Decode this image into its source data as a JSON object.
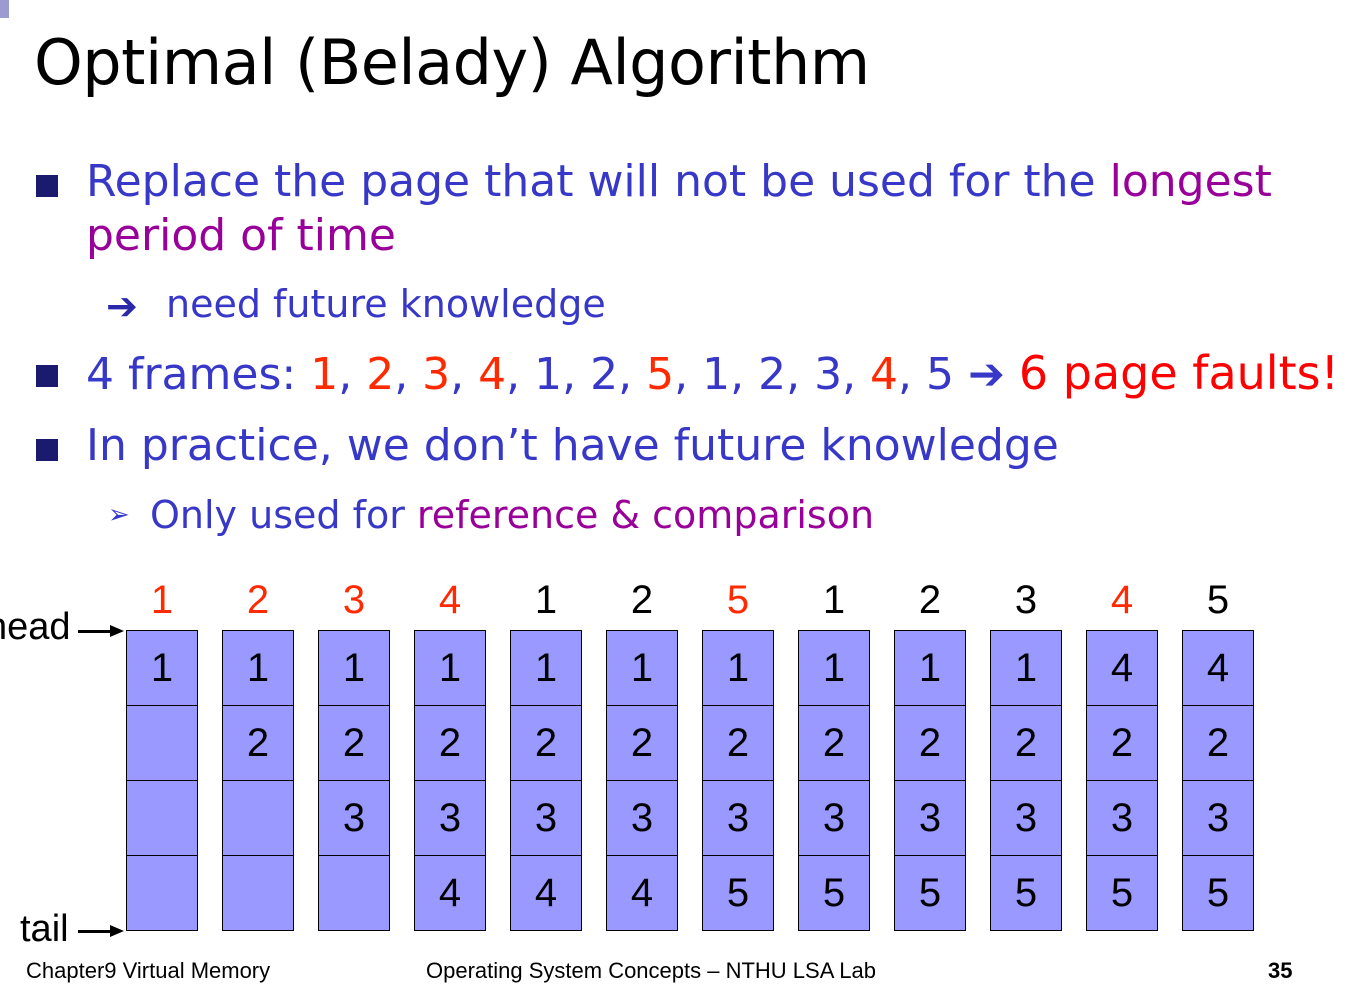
{
  "title": "Optimal (Belady) Algorithm",
  "bullets": {
    "b1_part1": "Replace the page that will not be used for the ",
    "b1_part2": "longest",
    "b1_line2": "period of time",
    "sub1": "need future knowledge",
    "b2_prefix": "4 frames: ",
    "b2_faults": "6 page faults!",
    "b3": "In practice, we don’t have future knowledge",
    "sub2_part1": "Only used for ",
    "sub2_part2": "reference & comparison"
  },
  "reference_string": [
    {
      "v": "1",
      "fault": true
    },
    {
      "v": "2",
      "fault": true
    },
    {
      "v": "3",
      "fault": true
    },
    {
      "v": "4",
      "fault": true
    },
    {
      "v": "1",
      "fault": false
    },
    {
      "v": "2",
      "fault": false
    },
    {
      "v": "5",
      "fault": true
    },
    {
      "v": "1",
      "fault": false
    },
    {
      "v": "2",
      "fault": false
    },
    {
      "v": "3",
      "fault": false
    },
    {
      "v": "4",
      "fault": true
    },
    {
      "v": "5",
      "fault": false
    }
  ],
  "frames": [
    [
      "1",
      "",
      "",
      ""
    ],
    [
      "1",
      "2",
      "",
      ""
    ],
    [
      "1",
      "2",
      "3",
      ""
    ],
    [
      "1",
      "2",
      "3",
      "4"
    ],
    [
      "1",
      "2",
      "3",
      "4"
    ],
    [
      "1",
      "2",
      "3",
      "4"
    ],
    [
      "1",
      "2",
      "3",
      "5"
    ],
    [
      "1",
      "2",
      "3",
      "5"
    ],
    [
      "1",
      "2",
      "3",
      "5"
    ],
    [
      "1",
      "2",
      "3",
      "5"
    ],
    [
      "4",
      "2",
      "3",
      "5"
    ],
    [
      "4",
      "2",
      "3",
      "5"
    ]
  ],
  "labels": {
    "head": "head",
    "tail": "tail"
  },
  "footer": {
    "left": "Chapter9 Virtual Memory",
    "center": "Operating System Concepts – NTHU LSA Lab",
    "page": "35"
  },
  "colors": {
    "frame_fill": "#9999ff",
    "fault": "#ff2a00",
    "text_blue": "#3838c8",
    "purple": "#990099"
  }
}
